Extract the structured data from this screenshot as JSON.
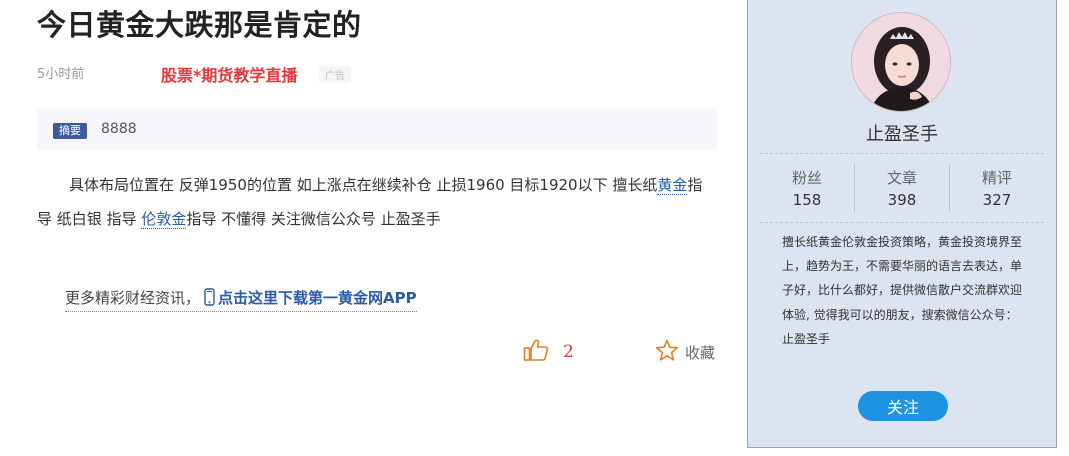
{
  "article": {
    "title": "今日黄金大跌那是肯定的",
    "time": "5小时前",
    "ad_link": "股票*期货教学直播",
    "ad_tag": "广告",
    "summary_label": "摘要",
    "summary_text": "8888",
    "body": {
      "part1": "具体布局位置在 反弹1950的位置  如上涨点在继续补仓 止损1960 目标1920以下 擅长纸",
      "keyword1": "黄金",
      "part2": "指导 纸白银 指导 ",
      "keyword2": "伦敦金",
      "part3": "指导 不懂得 关注微信公众号 止盈圣手"
    },
    "promo_prefix": "更多精彩财经资讯，",
    "promo_link": "点击这里下载第一黄金网APP",
    "like_count": "2",
    "favorite_label": "收藏"
  },
  "author": {
    "name": "止盈圣手",
    "stats": [
      {
        "label": "粉丝",
        "value": "158"
      },
      {
        "label": "文章",
        "value": "398"
      },
      {
        "label": "精评",
        "value": "327"
      }
    ],
    "bio": "擅长纸黄金伦敦金投资策略，黄金投资境界至上，趋势为王，不需要华丽的语言去表达，单子好，比什么都好，提供微信散户交流群欢迎体验, 觉得我可以的朋友，搜索微信公众号：止盈圣手",
    "follow_label": "关注"
  },
  "icons": {
    "like": "thumbs-up-icon",
    "favorite": "star-outline-icon",
    "promo": "phone-icon"
  },
  "colors": {
    "accent_red": "#e4393c",
    "link_blue": "#2b5aa6",
    "follow_button": "#1f93e3",
    "sidebar_bg": "#dce4f1"
  }
}
